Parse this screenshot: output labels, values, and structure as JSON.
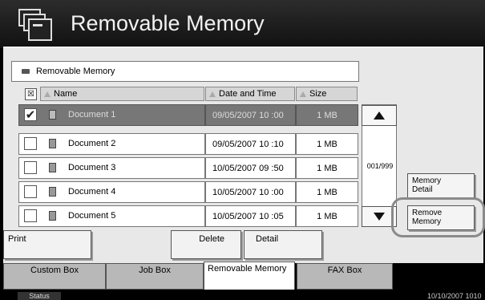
{
  "header": {
    "title": "Removable Memory",
    "icon": "removable-memory-icon"
  },
  "path": {
    "label": "Removable Memory"
  },
  "columns": {
    "name": "Name",
    "date": "Date and Time",
    "size": "Size"
  },
  "rows": [
    {
      "name": "Document 1",
      "date": "09/05/2007 10 :00",
      "size": "1 MB",
      "checked": "✔",
      "selected": true
    },
    {
      "name": "Document 2",
      "date": "09/05/2007 10 :10",
      "size": "1 MB",
      "checked": "",
      "selected": false
    },
    {
      "name": "Document 3",
      "date": "10/05/2007 09 :50",
      "size": "1 MB",
      "checked": "",
      "selected": false
    },
    {
      "name": "Document 4",
      "date": "10/05/2007 10 :00",
      "size": "1 MB",
      "checked": "",
      "selected": false
    },
    {
      "name": "Document 5",
      "date": "10/05/2007 10 :05",
      "size": "1 MB",
      "checked": "",
      "selected": false
    }
  ],
  "scroll": {
    "page": "001/999"
  },
  "right_buttons": {
    "detail": "Memory\nDetail",
    "remove": "Remove\nMemory"
  },
  "actions": {
    "print": "Print",
    "delete": "Delete",
    "detail": "Detail"
  },
  "tabs": [
    {
      "label": "Custom Box"
    },
    {
      "label": "Job Box"
    },
    {
      "label": "Removable Memory"
    },
    {
      "label": "FAX Box"
    }
  ],
  "footer": {
    "status": "Status",
    "datetime": "10/10/2007  1010"
  }
}
